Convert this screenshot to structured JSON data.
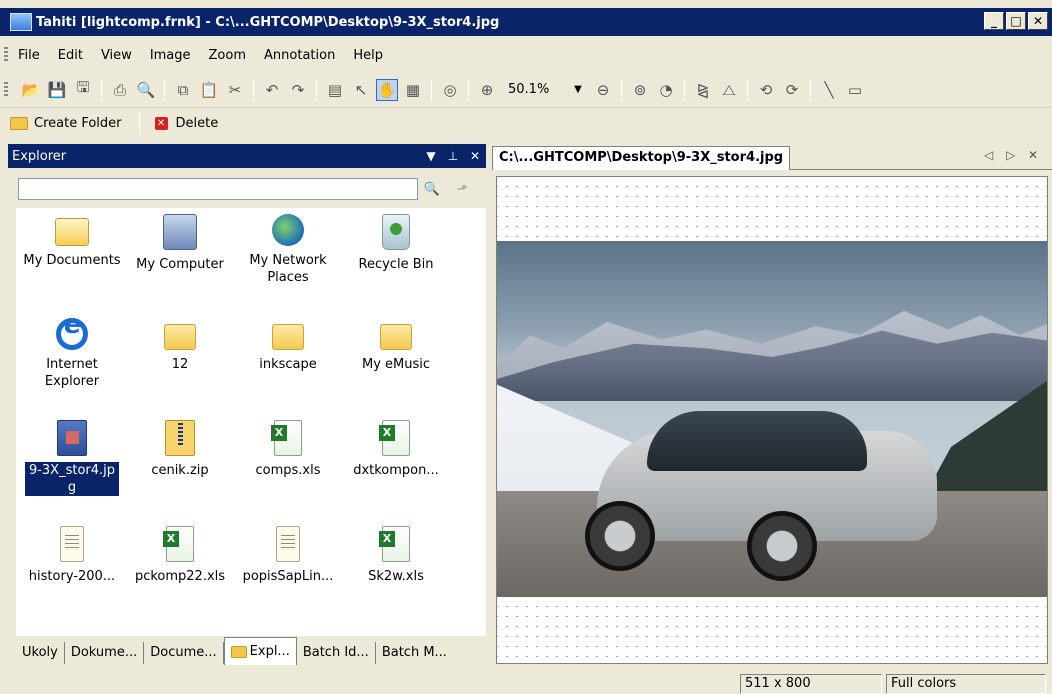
{
  "window": {
    "title": "Tahiti [lightcomp.frnk] - C:\\...GHTCOMP\\Desktop\\9-3X_stor4.jpg"
  },
  "menu": [
    "File",
    "Edit",
    "View",
    "Image",
    "Zoom",
    "Annotation",
    "Help"
  ],
  "toolbar": {
    "zoom_value": "50.1%"
  },
  "actions": {
    "create_folder": "Create Folder",
    "delete": "Delete"
  },
  "explorer": {
    "title": "Explorer",
    "items": [
      {
        "label": "My Documents",
        "icon": "my-documents-icon"
      },
      {
        "label": "My Computer",
        "icon": "my-computer-icon"
      },
      {
        "label": "My Network Places",
        "icon": "network-places-icon"
      },
      {
        "label": "Recycle Bin",
        "icon": "recycle-bin-icon"
      },
      {
        "label": "Internet Explorer",
        "icon": "internet-explorer-icon"
      },
      {
        "label": "12",
        "icon": "folder-icon"
      },
      {
        "label": "inkscape",
        "icon": "folder-icon"
      },
      {
        "label": "My eMusic",
        "icon": "folder-icon"
      },
      {
        "label": "9-3X_stor4.jpg",
        "icon": "image-file-icon"
      },
      {
        "label": "cenik.zip",
        "icon": "zip-file-icon"
      },
      {
        "label": "comps.xls",
        "icon": "excel-file-icon"
      },
      {
        "label": "dxtkompon...",
        "icon": "excel-file-icon"
      },
      {
        "label": "history-200...",
        "icon": "text-file-icon"
      },
      {
        "label": "pckomp22.xls",
        "icon": "excel-file-icon"
      },
      {
        "label": "popisSapLin...",
        "icon": "text-file-icon"
      },
      {
        "label": "Sk2w.xls",
        "icon": "excel-file-icon"
      }
    ],
    "tabs": [
      "Ukoly",
      "Dokume...",
      "Docume...",
      "Expl...",
      "Batch Id...",
      "Batch M..."
    ]
  },
  "viewer": {
    "tab_label": "C:\\...GHTCOMP\\Desktop\\9-3X_stor4.jpg"
  },
  "status": {
    "dimensions": "511 x 800",
    "colors": "Full colors"
  }
}
